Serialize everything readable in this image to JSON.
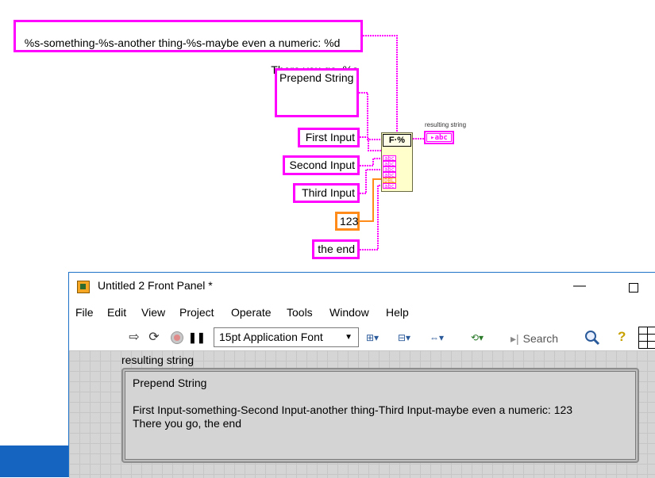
{
  "diagram": {
    "format_string": {
      "line1": "%s-something-%s-another thing-%s-maybe even a numeric: %d",
      "line2": "There you go, %s"
    },
    "prepend_string": "Prepend String",
    "inputs": {
      "first": "First Input",
      "second": "Second Input",
      "third": "Third Input",
      "numeric": "123",
      "last": "the end"
    },
    "format_node": {
      "glyph": "F·%",
      "terminals": [
        "abc",
        "abc",
        "abc",
        "abc",
        "DBL",
        "abc"
      ]
    },
    "result_indicator": {
      "label": "resulting string",
      "glyph": "▸abc"
    },
    "colors": {
      "string_wire": "#ff00ff",
      "numeric_wire": "#ff8c1a"
    }
  },
  "window": {
    "title": "Untitled 2 Front Panel *",
    "minimize": "—",
    "menu": [
      "File",
      "Edit",
      "View",
      "Project",
      "Operate",
      "Tools",
      "Window",
      "Help"
    ],
    "toolbar": {
      "font": "15pt Application Font",
      "search_placeholder": "Search"
    },
    "panel": {
      "indicator_label": "resulting string",
      "indicator_value": "Prepend String\n\nFirst Input-something-Second Input-another thing-Third Input-maybe even a numeric: 123\nThere you go, the end"
    }
  }
}
